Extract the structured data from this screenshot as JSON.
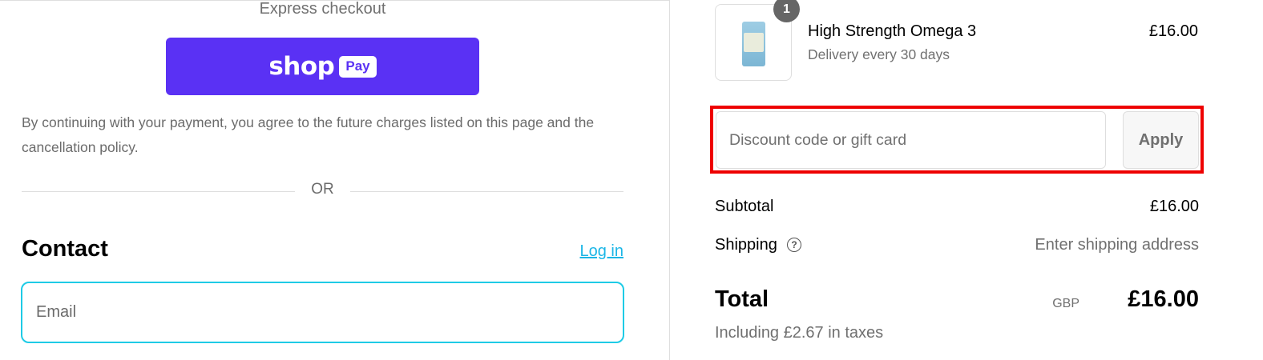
{
  "express": {
    "title": "Express checkout",
    "shop_pay": {
      "logo_text": "shop",
      "badge_text": "Pay",
      "color": "#5a31f4"
    }
  },
  "consent_text": "By continuing with your payment, you agree to the future charges listed on this page and the cancellation policy.",
  "divider_text": "OR",
  "contact": {
    "heading": "Contact",
    "login_label": "Log in",
    "email_placeholder": "Email",
    "email_value": ""
  },
  "order": {
    "item": {
      "name": "High Strength Omega 3",
      "subtitle": "Delivery every 30 days",
      "price": "£16.00",
      "quantity": "1"
    },
    "discount": {
      "placeholder": "Discount code or gift card",
      "apply_label": "Apply"
    },
    "subtotal": {
      "label": "Subtotal",
      "value": "£16.00"
    },
    "shipping": {
      "label": "Shipping",
      "help_icon": "?",
      "value": "Enter shipping address"
    },
    "total": {
      "label": "Total",
      "currency": "GBP",
      "value": "£16.00"
    },
    "tax_note": "Including £2.67 in taxes"
  },
  "colors": {
    "accent_link": "#1bb6e6",
    "email_focus_border": "#1ecbe6",
    "highlight_box": "#ee0000"
  }
}
